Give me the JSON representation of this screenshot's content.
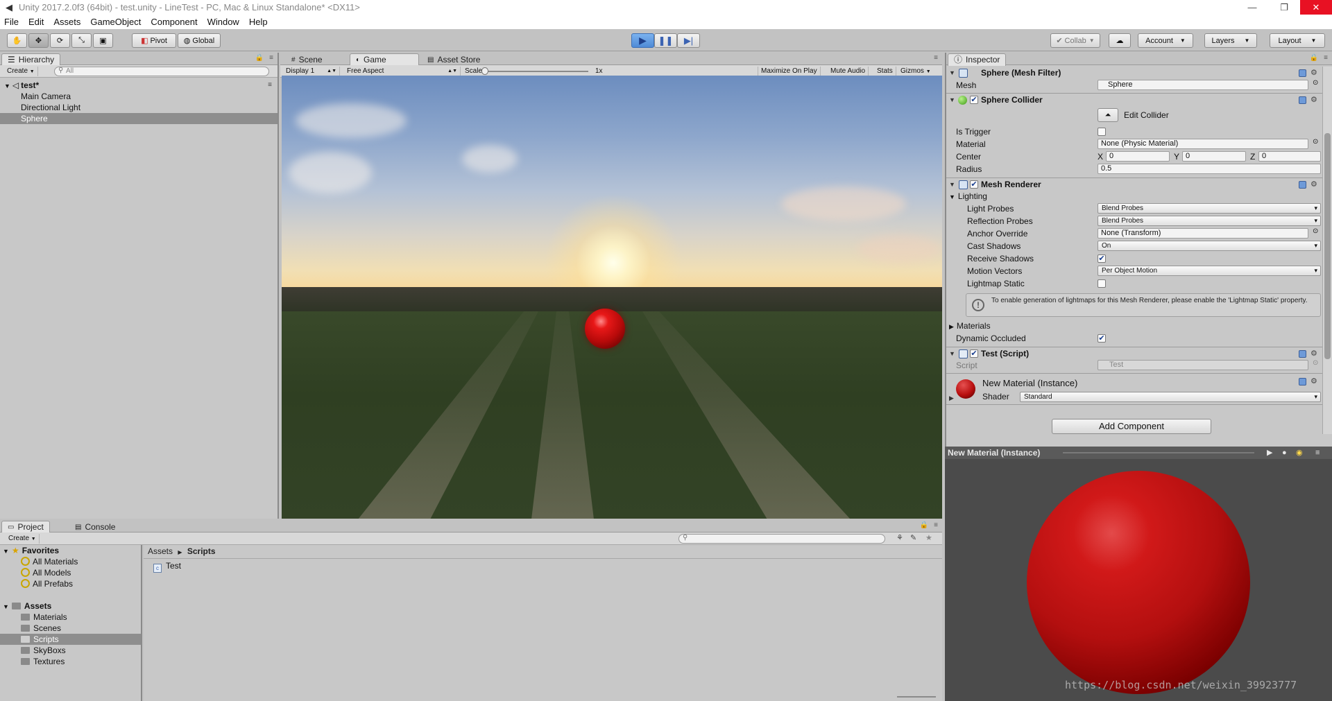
{
  "window": {
    "title": "Unity 2017.2.0f3 (64bit) - test.unity - LineTest - PC, Mac & Linux Standalone* <DX11>"
  },
  "menu": [
    "File",
    "Edit",
    "Assets",
    "GameObject",
    "Component",
    "Window",
    "Help"
  ],
  "toolbar": {
    "pivot": "Pivot",
    "global": "Global",
    "collab": "Collab",
    "account": "Account",
    "layers": "Layers",
    "layout": "Layout"
  },
  "hierarchy": {
    "tab": "Hierarchy",
    "create": "Create",
    "search_placeholder": "All",
    "scene": "test*",
    "items": [
      "Main Camera",
      "Directional Light",
      "Sphere"
    ]
  },
  "game": {
    "tabs": [
      "Scene",
      "Game",
      "Asset Store"
    ],
    "display": "Display 1",
    "aspect": "Free Aspect",
    "scale_label": "Scale",
    "scale_value": "1x",
    "buttons": [
      "Maximize On Play",
      "Mute Audio",
      "Stats",
      "Gizmos"
    ]
  },
  "inspector": {
    "tab": "Inspector",
    "mesh_filter": {
      "title": "Sphere (Mesh Filter)",
      "mesh_label": "Mesh",
      "mesh_value": "Sphere"
    },
    "sphere_collider": {
      "title": "Sphere Collider",
      "edit": "Edit Collider",
      "is_trigger": "Is Trigger",
      "material_label": "Material",
      "material_value": "None (Physic Material)",
      "center_label": "Center",
      "x": "0",
      "y": "0",
      "z": "0",
      "radius_label": "Radius",
      "radius": "0.5"
    },
    "mesh_renderer": {
      "title": "Mesh Renderer",
      "lighting": "Lighting",
      "light_probes_label": "Light Probes",
      "light_probes": "Blend Probes",
      "reflection_label": "Reflection Probes",
      "reflection": "Blend Probes",
      "anchor_label": "Anchor Override",
      "anchor": "None (Transform)",
      "cast_label": "Cast Shadows",
      "cast": "On",
      "receive_label": "Receive Shadows",
      "motion_label": "Motion Vectors",
      "motion": "Per Object Motion",
      "lightmap_label": "Lightmap Static",
      "info": "To enable generation of lightmaps for this Mesh Renderer, please enable the 'Lightmap Static' property.",
      "materials": "Materials",
      "dynamic": "Dynamic Occluded"
    },
    "test_script": {
      "title": "Test (Script)",
      "script_label": "Script",
      "script": "Test"
    },
    "material": {
      "title": "New Material (Instance)",
      "shader_label": "Shader",
      "shader": "Standard"
    },
    "add_component": "Add Component"
  },
  "preview": {
    "title": "New Material (Instance)"
  },
  "project": {
    "tabs": [
      "Project",
      "Console"
    ],
    "create": "Create",
    "favorites": "Favorites",
    "fav_items": [
      "All Materials",
      "All Models",
      "All Prefabs"
    ],
    "assets": "Assets",
    "folders": [
      "Materials",
      "Scenes",
      "Scripts",
      "SkyBoxs",
      "Textures"
    ],
    "breadcrumb": [
      "Assets",
      "Scripts"
    ],
    "files": [
      "Test"
    ]
  },
  "watermark": "https://blog.csdn.net/weixin_39923777",
  "colors": {
    "accent": "#4e8ad6",
    "selection": "#8e8e8e",
    "ball": "#d11919"
  }
}
